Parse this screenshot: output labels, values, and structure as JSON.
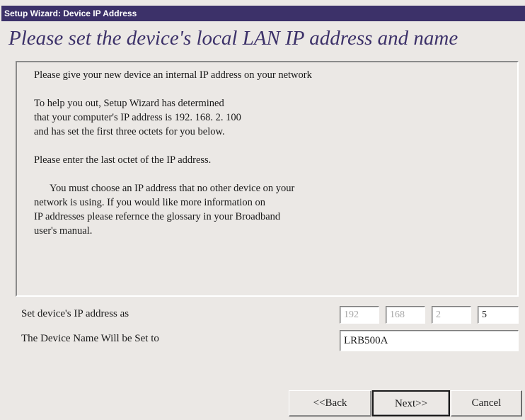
{
  "window": {
    "title": "Setup Wizard: Device IP Address"
  },
  "heading": "Please set the device's local LAN IP address and name",
  "info": {
    "line1": "Please give your new device an internal IP address on your network",
    "line2": "To help you out, Setup Wizard has determined",
    "line3": "that your computer's IP address is 192. 168. 2. 100",
    "line4": "and has set the first three octets for you below.",
    "line5": "Please enter the last octet of the IP address.",
    "line6": "You must choose an IP address that no other device on your",
    "line7": "network is using.  If you would like more information on",
    "line8": "IP addresses please refernce the glossary in your Broadband",
    "line9": "user's manual."
  },
  "ip_field": {
    "label": "Set device's IP address as",
    "octets": [
      "192",
      "168",
      "2",
      "5"
    ]
  },
  "name_field": {
    "label": "The Device Name Will be Set to",
    "value": "LRB500A"
  },
  "buttons": {
    "back": "<<Back",
    "next": "Next>>",
    "cancel": "Cancel"
  }
}
